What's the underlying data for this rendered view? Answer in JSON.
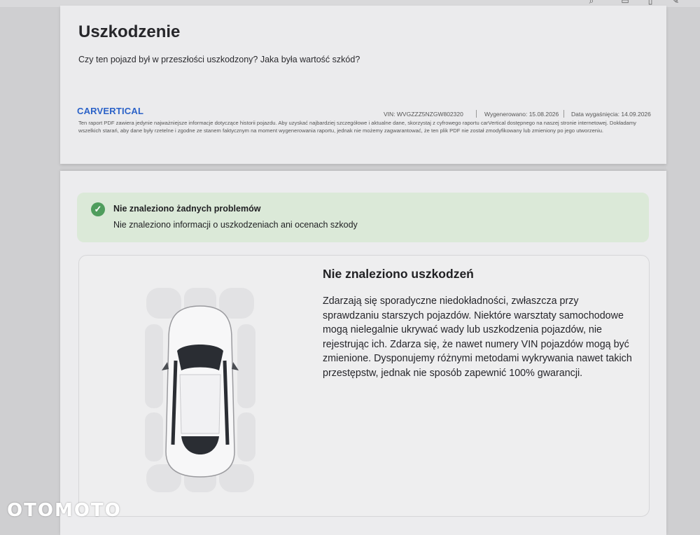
{
  "damage_section": {
    "title": "Uszkodzenie",
    "subtitle": "Czy ten pojazd był w przeszłości uszkodzony? Jaka była wartość szkód?"
  },
  "report_footer": {
    "brand": "CARVERTICAL",
    "vin": "VIN: WVGZZZ5NZGW802320",
    "generated": "Wygenerowano: 15.08.2026",
    "expiry": "Data wygaśnięcia: 14.09.2026",
    "disclaimer": "Ten raport PDF zawiera jedynie najważniejsze informacje dotyczące historii pojazdu. Aby uzyskać najbardziej szczegółowe i aktualne dane, skorzystaj z cyfrowego raportu carVertical dostępnego na naszej stronie internetowej. Dokładamy wszelkich starań, aby dane były rzetelne i zgodne ze stanem faktycznym na moment wygenerowania raportu, jednak nie możemy zagwarantować, że ten plik PDF nie został zmodyfikowany lub zmieniony po jego utworzeniu."
  },
  "status_banner": {
    "title": "Nie znaleziono żadnych problemów",
    "text": "Nie znaleziono informacji o uszkodzeniach ani ocenach szkody",
    "icon": "check-icon",
    "color": "#4f9d5d"
  },
  "damage_card": {
    "title": "Nie znaleziono uszkodzeń",
    "body": "Zdarzają się sporadyczne niedokładności, zwłaszcza przy sprawdzaniu starszych pojazdów. Niektóre warsztaty samochodowe mogą nielegalnie ukrywać wady lub uszkodzenia pojazdów, nie rejestrując ich. Zdarza się, że nawet numery VIN pojazdów mogą być zmienione. Dysponujemy różnymi metodami wykrywania nawet takich przestępstw, jednak nie sposób zapewnić 100% gwarancji."
  },
  "watermark": "OTOMOTO",
  "toolbar_icons": [
    "search-icon",
    "print-icon",
    "save-icon",
    "edit-icon"
  ]
}
